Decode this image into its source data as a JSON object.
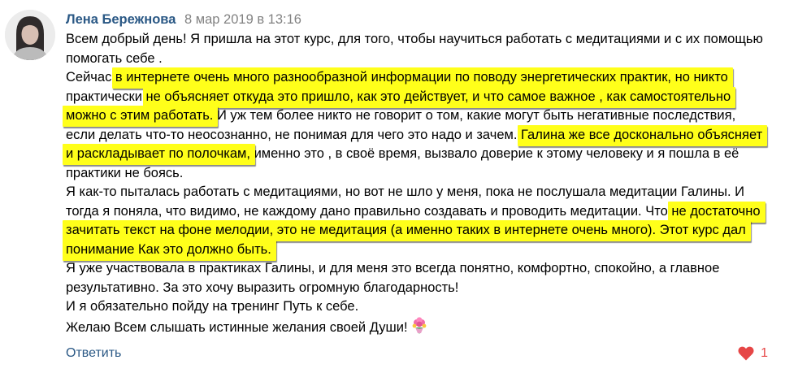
{
  "comment": {
    "author": "Лена Бережнова",
    "date": "8 мар 2019 в 13:16",
    "avatar_icon": "user-photo-avatar",
    "lines": [
      [
        {
          "t": "Всем добрый день! Я пришла на этот курс, для того, чтобы научиться работать с медитациями и с их помощью"
        }
      ],
      [
        {
          "t": "помогать себе ."
        }
      ],
      [
        {
          "t": "Сейчас "
        },
        {
          "t": "в интернете очень много разнообразной информации по поводу энергетических практик, но никто",
          "hl": true
        }
      ],
      [
        {
          "t": "практически "
        },
        {
          "t": "не объясняет откуда это пришло, как это действует, и что самое важное , как самостоятельно",
          "hl": true
        }
      ],
      [
        {
          "t": "можно с этим работать.",
          "hl": true
        },
        {
          "t": " И уж тем более никто не говорит о том, какие могут быть негативные последствия,"
        }
      ],
      [
        {
          "t": "если делать что-то неосознанно, не понимая для чего это надо и зачем. "
        },
        {
          "t": "Галина же все досконально объясняет",
          "hl": true
        }
      ],
      [
        {
          "t": "и раскладывает по полочкам,",
          "hl": true
        },
        {
          "t": " именно это , в своё время, вызвало доверие к этому человеку и я пошла в её"
        }
      ],
      [
        {
          "t": "практики не боясь."
        }
      ],
      [
        {
          "t": "Я как-то пыталась работать с медитациями, но вот не шло у меня, пока не послушала медитации Галины. И"
        }
      ],
      [
        {
          "t": "тогда я поняла, что видимо, не каждому дано правильно создавать и проводить медитации. Что "
        },
        {
          "t": "не достаточно",
          "hl": true
        }
      ],
      [
        {
          "t": "зачитать текст на фоне мелодии, это не медитация (а именно таких в интернете очень много). Этот курс дал",
          "hl": true
        }
      ],
      [
        {
          "t": "понимание Как это должно быть.",
          "hl": true
        }
      ],
      [
        {
          "t": "Я уже участвовала в практиках Галины, и для меня это всегда понятно, комфортно, спокойно, а главное"
        }
      ],
      [
        {
          "t": "результативно. За это хочу выразить огромную благодарность!"
        }
      ],
      [
        {
          "t": "И я обязательно пойду на тренинг Путь к себе."
        }
      ],
      [
        {
          "t": "Желаю Всем слышать истинные желания своей Души!"
        },
        {
          "icon": "flower-bouquet-emoji"
        }
      ]
    ],
    "highlight_color": "#ffff1a",
    "link_color": "#2a5885"
  },
  "footer": {
    "reply_label": "Ответить",
    "like_icon": "heart-icon",
    "like_count": "1",
    "like_color": "#e64646"
  }
}
